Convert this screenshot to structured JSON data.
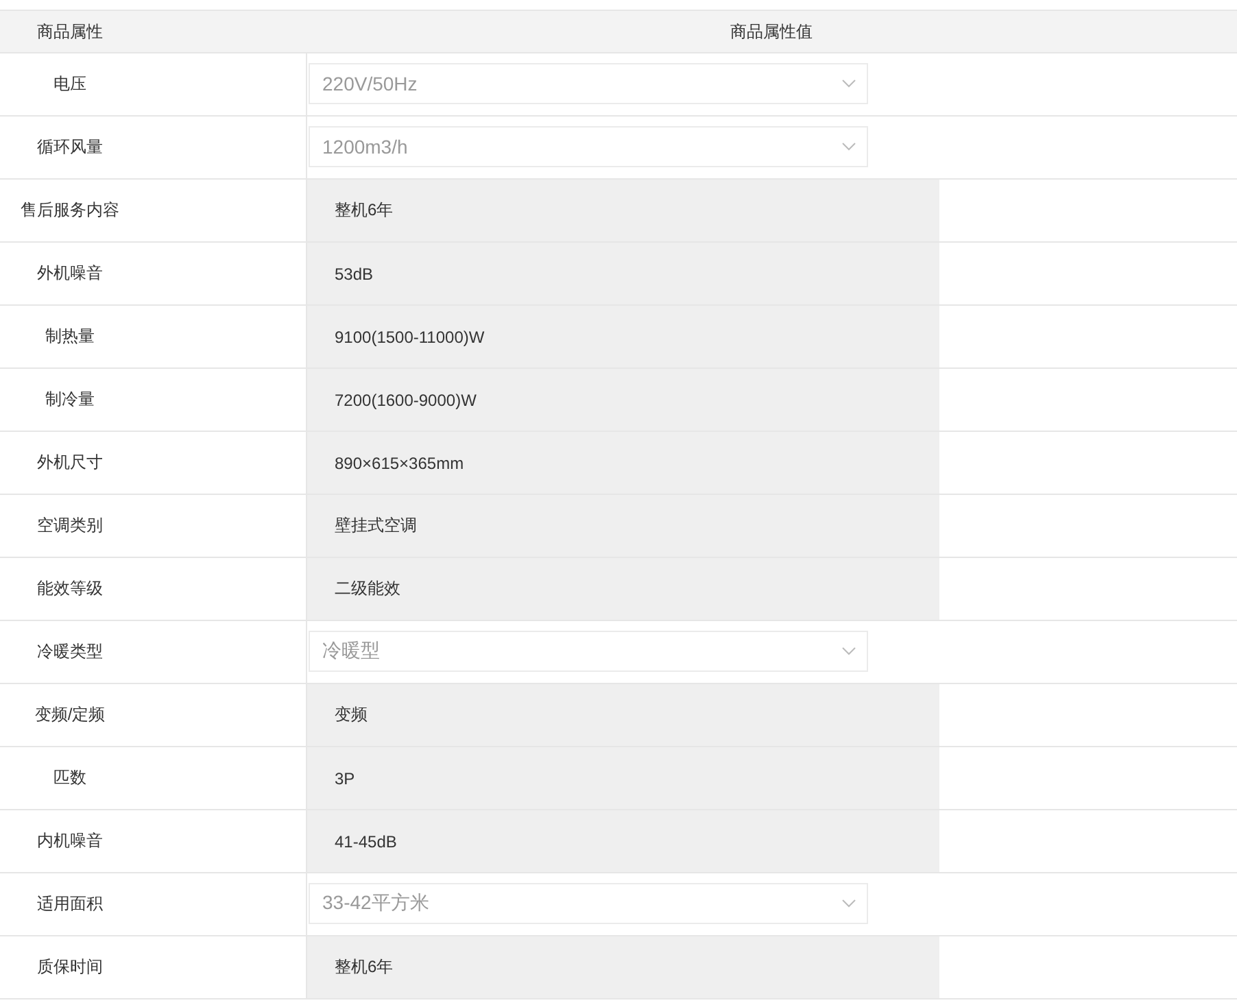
{
  "table": {
    "columns": [
      "商品属性",
      "商品属性值"
    ],
    "rows": [
      {
        "name": "电压",
        "kind": "select",
        "value": "220V/50Hz"
      },
      {
        "name": "循环风量",
        "kind": "select",
        "value": "1200m3/h"
      },
      {
        "name": "售后服务内容",
        "kind": "text",
        "value": "整机6年"
      },
      {
        "name": "外机噪音",
        "kind": "text",
        "value": "53dB"
      },
      {
        "name": "制热量",
        "kind": "text",
        "value": "9100(1500-11000)W"
      },
      {
        "name": "制冷量",
        "kind": "text",
        "value": "7200(1600-9000)W"
      },
      {
        "name": "外机尺寸",
        "kind": "text",
        "value": "890×615×365mm"
      },
      {
        "name": "空调类别",
        "kind": "text",
        "value": "壁挂式空调"
      },
      {
        "name": "能效等级",
        "kind": "text",
        "value": "二级能效"
      },
      {
        "name": "冷暖类型",
        "kind": "select",
        "value": "冷暖型"
      },
      {
        "name": "变频/定频",
        "kind": "text",
        "value": "变频"
      },
      {
        "name": "匹数",
        "kind": "text",
        "value": "3P"
      },
      {
        "name": "内机噪音",
        "kind": "text",
        "value": "41-45dB"
      },
      {
        "name": "适用面积",
        "kind": "select",
        "value": "33-42平方米"
      },
      {
        "name": "质保时间",
        "kind": "text",
        "value": "整机6年"
      }
    ]
  }
}
